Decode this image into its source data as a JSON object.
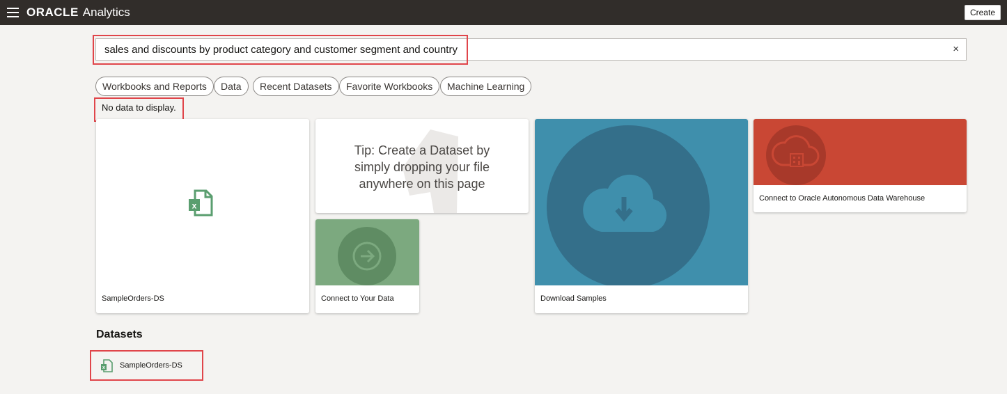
{
  "app": {
    "brand_oracle": "ORACLE",
    "brand_product": "Analytics",
    "create_label": "Create"
  },
  "search": {
    "value": "sales and discounts by product category and customer segment and country",
    "clear_glyph": "×"
  },
  "filters": [
    {
      "label": "Workbooks and Reports"
    },
    {
      "label": "Data"
    },
    {
      "label": "Recent Datasets"
    },
    {
      "label": "Favorite Workbooks"
    },
    {
      "label": "Machine Learning"
    }
  ],
  "results": {
    "empty_message": "No data to display."
  },
  "cards": {
    "dataset": {
      "label": "SampleOrders-DS",
      "icon": "excel-file-icon"
    },
    "tip": {
      "text_line1": "Tip: Create a Dataset by",
      "text_line2": "simply dropping your file",
      "text_line3": "anywhere on this page"
    },
    "connect": {
      "label": "Connect to Your Data",
      "icon": "arrow-circle-right-icon",
      "color": "#7ca97f"
    },
    "download": {
      "label": "Download Samples",
      "icon": "cloud-download-icon",
      "color": "#3f8fac"
    },
    "adw": {
      "label": "Connect to Oracle Autonomous Data Warehouse",
      "icon": "cloud-database-icon",
      "color": "#c94734"
    }
  },
  "datasets_section": {
    "title": "Datasets",
    "items": [
      {
        "label": "SampleOrders-DS",
        "icon": "excel-file-icon"
      }
    ]
  },
  "colors": {
    "topbar": "#312d2a",
    "background": "#f4f3f1",
    "highlight": "#e0454a",
    "excel_green": "#5a9e6f"
  }
}
